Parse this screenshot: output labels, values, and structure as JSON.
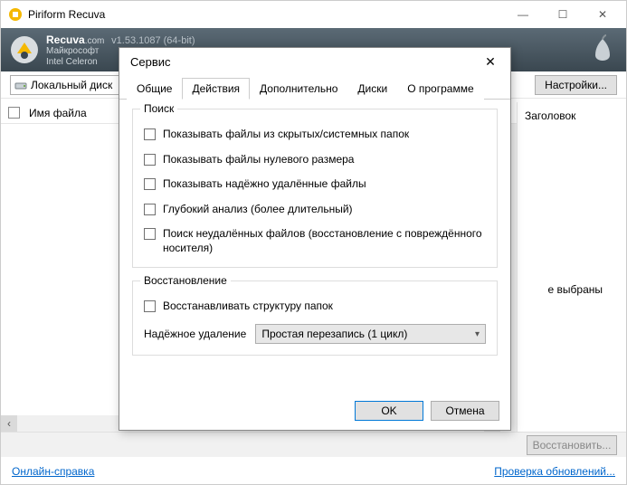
{
  "window": {
    "title": "Piriform Recuva",
    "product": "Recuva",
    "domain": ".com",
    "version": "v1.53.1087 (64-bit)",
    "sub1": "Майкрософт",
    "sub2": "Intel Celeron"
  },
  "toolbar": {
    "drive_label": "Локальный диск",
    "settings_btn": "Настройки..."
  },
  "list": {
    "col_filename": "Имя файла"
  },
  "right": {
    "header": "Заголовок",
    "no_selection": "е выбраны"
  },
  "bottom": {
    "restore_btn": "Восстановить..."
  },
  "status": {
    "help_link": "Онлайн-справка",
    "update_link": "Проверка обновлений..."
  },
  "dialog": {
    "title": "Сервис",
    "close": "✕",
    "tabs": [
      "Общие",
      "Действия",
      "Дополнительно",
      "Диски",
      "О программе"
    ],
    "group_search": "Поиск",
    "chk1": "Показывать файлы из скрытых/системных папок",
    "chk2": "Показывать файлы нулевого размера",
    "chk3": "Показывать надёжно удалённые файлы",
    "chk4": "Глубокий анализ (более длительный)",
    "chk5": "Поиск неудалённых файлов (восстановление с повреждённого носителя)",
    "group_restore": "Восстановление",
    "chk_restore": "Восстанавливать структуру папок",
    "secure_delete_label": "Надёжное удаление",
    "secure_delete_value": "Простая перезапись (1 цикл)",
    "ok": "OK",
    "cancel": "Отмена"
  }
}
